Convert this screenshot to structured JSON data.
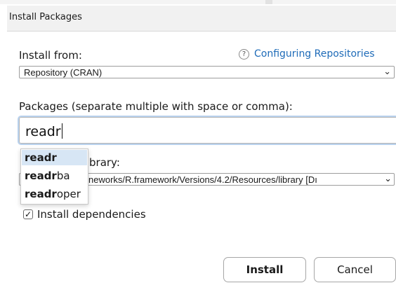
{
  "dialog": {
    "title": "Install Packages"
  },
  "install_from": {
    "label": "Install from:",
    "help_link": "Configuring Repositories",
    "help_icon": "question-mark-icon",
    "selected": "Repository (CRAN)"
  },
  "packages": {
    "label": "Packages (separate multiple with space or comma):",
    "value": "readr"
  },
  "autocomplete": {
    "items": [
      {
        "match": "readr",
        "rest": ""
      },
      {
        "match": "readr",
        "rest": "ba"
      },
      {
        "match": "readr",
        "rest": "oper"
      }
    ],
    "selected_index": 0
  },
  "library": {
    "label_visible": "brary:",
    "selected_visible": "neworks/R.framework/Versions/4.2/Resources/library [Dı"
  },
  "dependencies": {
    "label": "Install dependencies",
    "checked": true
  },
  "buttons": {
    "install": "Install",
    "cancel": "Cancel"
  },
  "colors": {
    "link": "#1e6bb8",
    "selection": "#d7e6f5",
    "focus_ring": "#b9d2ee"
  }
}
